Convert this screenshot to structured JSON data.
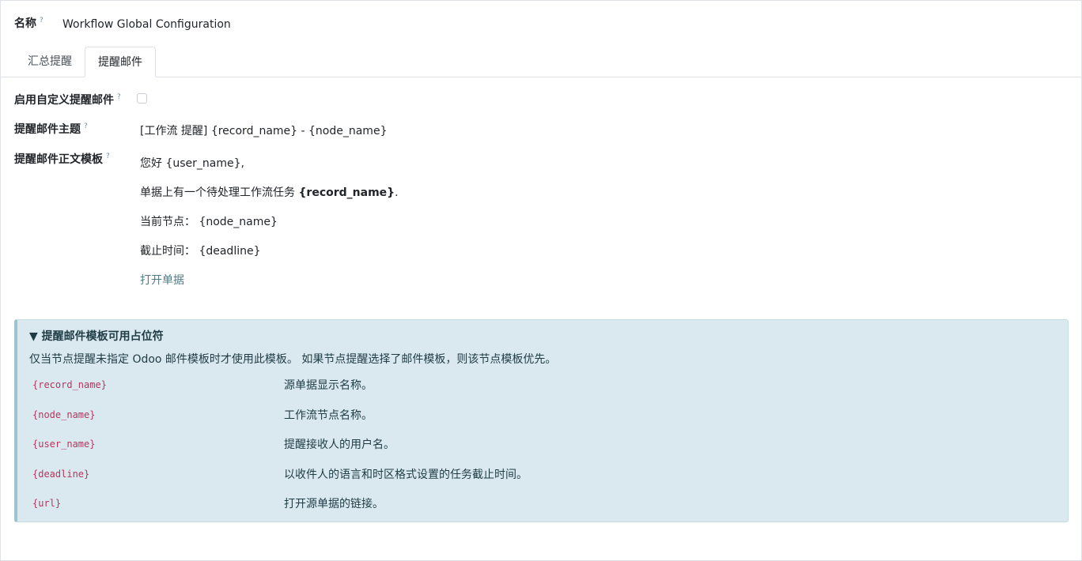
{
  "form": {
    "name_label": "名称",
    "help_mark": "?",
    "name_value": "Workflow Global Configuration"
  },
  "tabs": [
    {
      "label": "汇总提醒",
      "active": false
    },
    {
      "label": "提醒邮件",
      "active": true
    }
  ],
  "fields": {
    "enable_label": "启用自定义提醒邮件",
    "enable_checked": false,
    "subject_label": "提醒邮件主题",
    "subject_value": "[工作流 提醒] {record_name} - {node_name}",
    "body_label": "提醒邮件正文模板"
  },
  "body_template": {
    "greeting": "您好 {user_name},",
    "line1_prefix": "单据上有一个待处理工作流任务 ",
    "line1_bold": "{record_name}",
    "line1_suffix": ".",
    "node_line": "当前节点： {node_name}",
    "deadline_line": "截止时间： {deadline}",
    "open_link": "打开单据"
  },
  "placeholders_box": {
    "title": "▼ 提醒邮件模板可用占位符",
    "description": "仅当节点提醒未指定 Odoo 邮件模板时才使用此模板。 如果节点提醒选择了邮件模板，则该节点模板优先。",
    "items": [
      {
        "code": "{record_name}",
        "desc": "源单据显示名称。"
      },
      {
        "code": "{node_name}",
        "desc": "工作流节点名称。"
      },
      {
        "code": "{user_name}",
        "desc": "提醒接收人的用户名。"
      },
      {
        "code": "{deadline}",
        "desc": "以收件人的语言和时区格式设置的任务截止时间。"
      },
      {
        "code": "{url}",
        "desc": "打开源单据的链接。"
      }
    ]
  },
  "colors": {
    "info_bg": "#d9e9ef",
    "code_color": "#b4365e",
    "link_color": "#4e7b87"
  }
}
